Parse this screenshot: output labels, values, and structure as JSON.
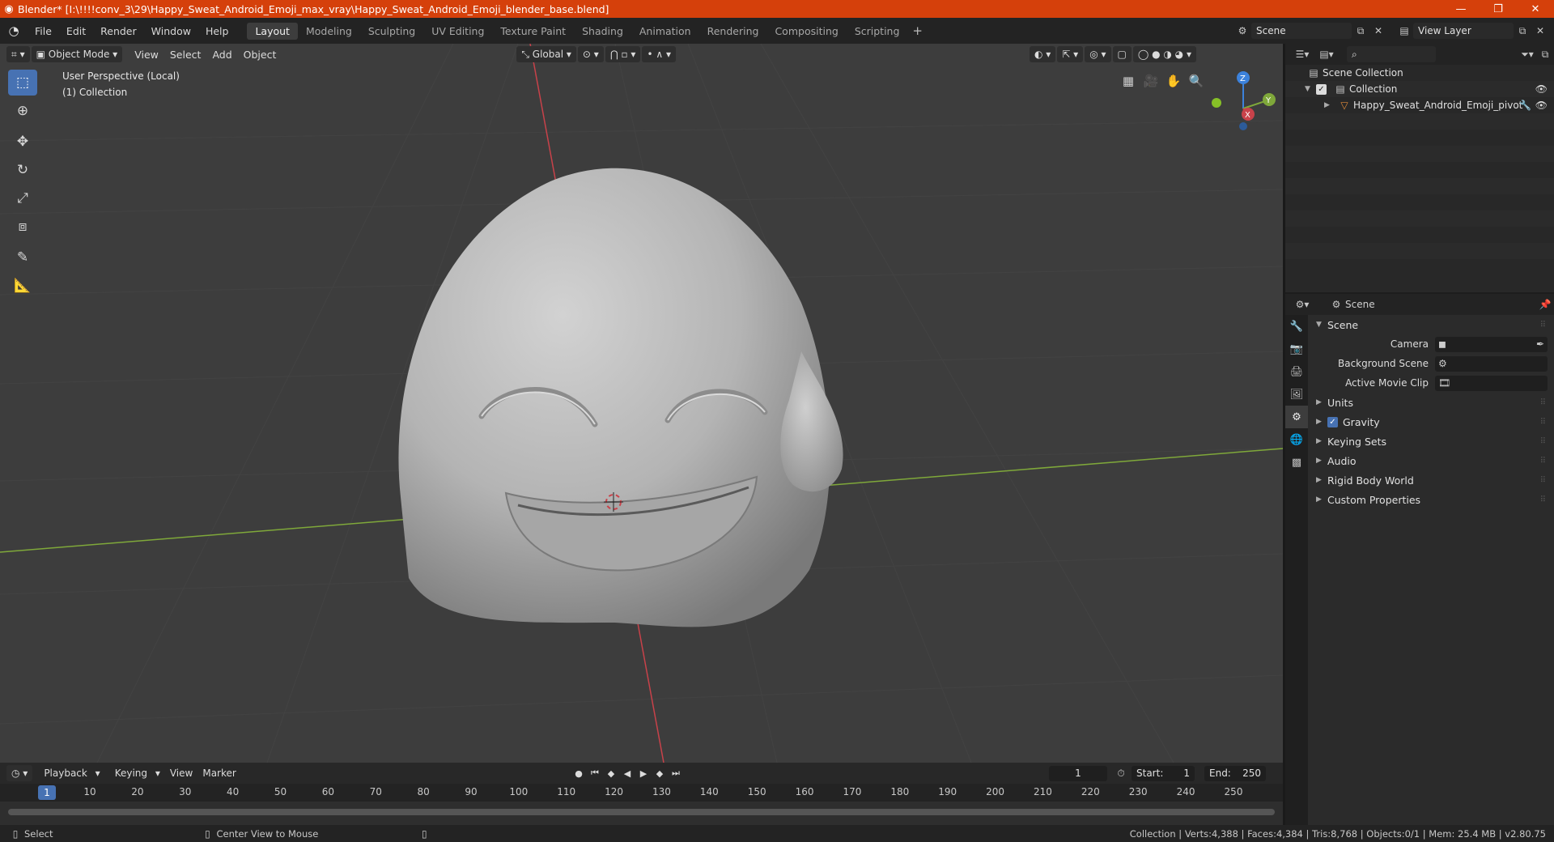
{
  "titlebar": {
    "title": "Blender* [I:\\!!!!conv_3\\29\\Happy_Sweat_Android_Emoji_max_vray\\Happy_Sweat_Android_Emoji_blender_base.blend]",
    "minimize": "—",
    "restore": "❐",
    "close": "✕"
  },
  "menu": {
    "file": "File",
    "edit": "Edit",
    "render": "Render",
    "window": "Window",
    "help": "Help"
  },
  "workspaces": [
    "Layout",
    "Modeling",
    "Sculpting",
    "UV Editing",
    "Texture Paint",
    "Shading",
    "Animation",
    "Rendering",
    "Compositing",
    "Scripting"
  ],
  "scene_selector": {
    "value": "Scene"
  },
  "view_layer_selector": {
    "value": "View Layer"
  },
  "viewport": {
    "mode": "Object Mode",
    "menu": {
      "view": "View",
      "select": "Select",
      "add": "Add",
      "object": "Object"
    },
    "orientation": "Global",
    "info_line1": "User Perspective (Local)",
    "info_line2": "(1) Collection",
    "gizmo": {
      "z": "Z",
      "y": "Y",
      "x": "X"
    }
  },
  "outliner": {
    "scene_collection": "Scene Collection",
    "collection": "Collection",
    "object": "Happy_Sweat_Android_Emoji_pivot"
  },
  "properties": {
    "header": "Scene",
    "panel_scene": "Scene",
    "camera_label": "Camera",
    "background_scene_label": "Background Scene",
    "active_movie_clip_label": "Active Movie Clip",
    "panels": [
      "Units",
      "Gravity",
      "Keying Sets",
      "Audio",
      "Rigid Body World",
      "Custom Properties"
    ]
  },
  "timeline": {
    "menu": {
      "playback": "Playback",
      "keying": "Keying",
      "view": "View",
      "marker": "Marker"
    },
    "current_frame": "1",
    "start_label": "Start:",
    "start": "1",
    "end_label": "End:",
    "end": "250",
    "ticks": [
      "10",
      "20",
      "30",
      "40",
      "50",
      "60",
      "70",
      "80",
      "90",
      "100",
      "110",
      "120",
      "130",
      "140",
      "150",
      "160",
      "170",
      "180",
      "190",
      "200",
      "210",
      "220",
      "230",
      "240",
      "250"
    ],
    "cursor": "1"
  },
  "statusbar": {
    "select": "Select",
    "center_view": "Center View to Mouse",
    "stats": "Collection | Verts:4,388 | Faces:4,384 | Tris:8,768 | Objects:0/1 | Mem: 25.4 MB | v2.80.75"
  },
  "colors": {
    "titlebar": "#d5400b",
    "accent": "#4772b3",
    "viewport_bg": "#3d3d3d",
    "x_axis": "#c8424a",
    "y_axis": "#7fa83a",
    "z_axis": "#3c82dc"
  }
}
